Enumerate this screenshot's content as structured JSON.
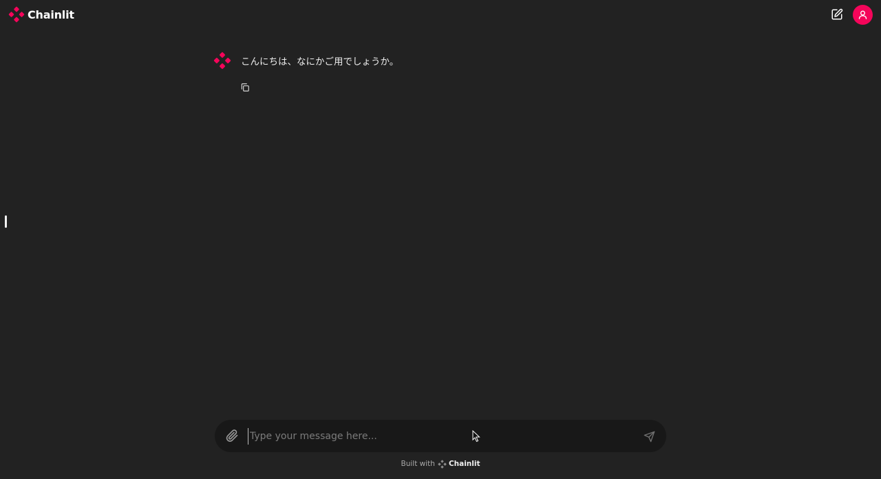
{
  "header": {
    "brand_name": "Chainlit",
    "brand_color": "#f4055a",
    "icons": [
      "chainlit-logo-icon",
      "edit-icon",
      "user-icon"
    ]
  },
  "messages": [
    {
      "author_icon": "chainlit-logo-icon",
      "text": "こんにちは、なにかご用でしょうか。",
      "actions": [
        "copy-icon"
      ]
    }
  ],
  "composer": {
    "value": "",
    "placeholder": "Type your message here...",
    "icons": [
      "paperclip-icon",
      "send-icon"
    ]
  },
  "footer": {
    "built_with": "Built with",
    "brand_name": "Chainlit"
  },
  "colors": {
    "background": "#222222",
    "accent": "#f4055a",
    "composer_bg": "#181818"
  }
}
